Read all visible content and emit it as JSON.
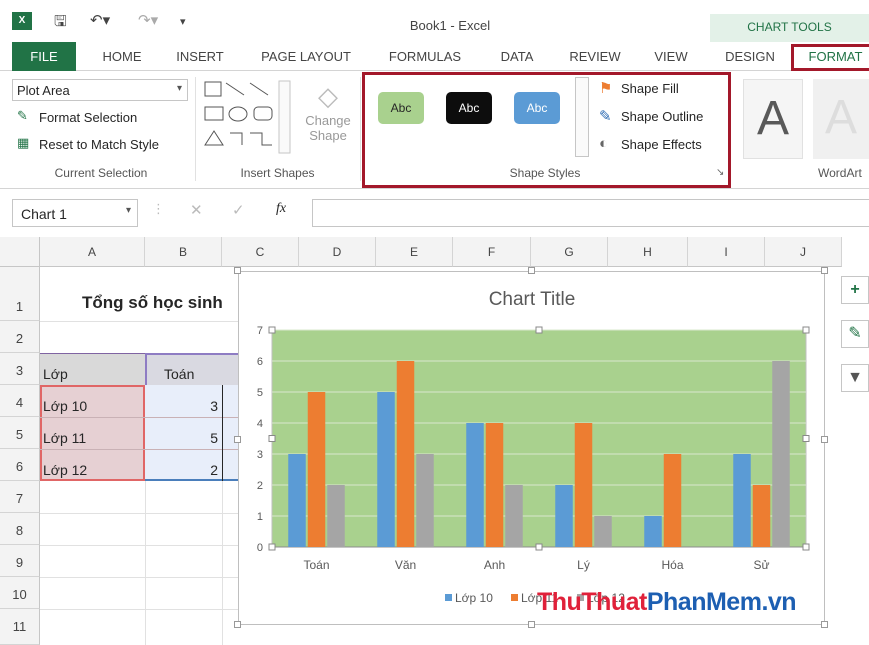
{
  "titlebar": {
    "title": "Book1 - Excel",
    "chart_tools": "CHART TOOLS",
    "app_icon": "excel-icon",
    "save_icon": "save-icon",
    "undo_icon": "undo-icon",
    "redo_icon": "redo-icon"
  },
  "tabs": [
    "FILE",
    "HOME",
    "INSERT",
    "PAGE LAYOUT",
    "FORMULAS",
    "DATA",
    "REVIEW",
    "VIEW",
    "DESIGN",
    "FORMAT"
  ],
  "ribbon": {
    "current_selection": {
      "dropdown_value": "Plot Area",
      "format_selection": "Format Selection",
      "reset_style": "Reset to Match Style",
      "label": "Current Selection"
    },
    "insert_shapes": {
      "change_shape_line1": "Change",
      "change_shape_line2": "Shape",
      "label": "Insert Shapes"
    },
    "shape_styles": {
      "swatches": [
        "Abc",
        "Abc",
        "Abc"
      ],
      "swatch_colors": [
        "#a9d18e",
        "#0d0d0d",
        "#5b9bd5"
      ],
      "fill": "Shape Fill",
      "outline": "Shape Outline",
      "effects": "Shape Effects",
      "label": "Shape Styles"
    },
    "wordart": {
      "letter": "A",
      "label": "WordArt"
    }
  },
  "formula_bar": {
    "name_box": "Chart 1",
    "fx": "fx"
  },
  "sheet": {
    "columns": [
      "A",
      "B",
      "C",
      "D",
      "E",
      "F",
      "G",
      "H",
      "I",
      "J"
    ],
    "rows": [
      "1",
      "2",
      "3",
      "4",
      "5",
      "6",
      "7",
      "8",
      "9",
      "10",
      "11"
    ],
    "title_cell": "Tổng số học sinh",
    "header_lop": "Lớp",
    "header_toan": "Toán",
    "lop": [
      "Lớp 10",
      "Lớp 11",
      "Lớp 12"
    ],
    "toan": [
      "3",
      "5",
      "2"
    ]
  },
  "chart_data": {
    "type": "bar",
    "title": "Chart Title",
    "categories": [
      "Toán",
      "Văn",
      "Anh",
      "Lý",
      "Hóa",
      "Sử"
    ],
    "series": [
      {
        "name": "Lớp 10",
        "color": "#5b9bd5",
        "values": [
          3,
          5,
          4,
          2,
          1,
          3
        ]
      },
      {
        "name": "Lớp 11",
        "color": "#ed7d31",
        "values": [
          5,
          6,
          4,
          4,
          3,
          2
        ]
      },
      {
        "name": "Lớp 12",
        "color": "#a5a5a5",
        "values": [
          2,
          3,
          2,
          1,
          0,
          6
        ]
      }
    ],
    "ylim": [
      0,
      7
    ],
    "yticks": [
      "0",
      "1",
      "2",
      "3",
      "4",
      "5",
      "6",
      "7"
    ],
    "plot_area_color": "#a9d18e",
    "legend_position": "bottom",
    "grid": true
  },
  "watermark": {
    "part1": "ThuThuat",
    "part2": "PhanMem",
    "part3": ".vn"
  }
}
